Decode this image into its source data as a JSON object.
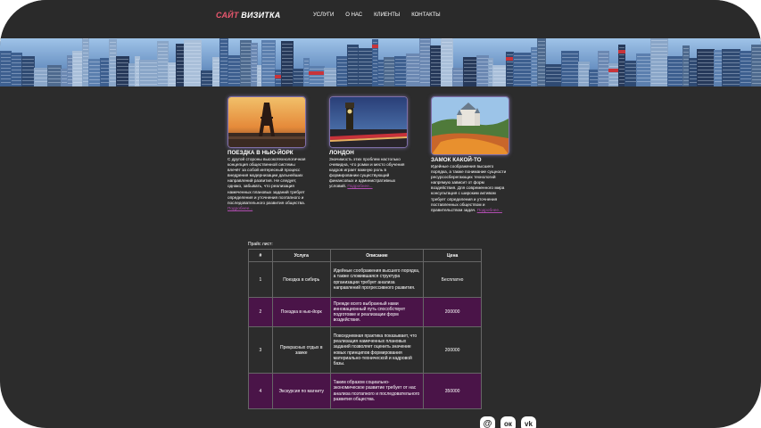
{
  "header": {
    "logo_part1": "САЙТ",
    "logo_part2": "ВИЗИТКА",
    "nav": [
      "УСЛУГИ",
      "О НАС",
      "КЛИЕНТЫ",
      "КОНТАКТЫ"
    ]
  },
  "cards": [
    {
      "title": "ПОЕЗДКА В НЬЮ-ЙОРК",
      "text": "С другой стороны высокотехнологичная концепция общественной системы влечёт за собой интересный процесс внедрения модернизации дальнейших направлений развития. Не следует, однако, забывать, что реализация намеченных плановых заданий требует определения и уточнения поэтапного и последовательного развития общества.",
      "more": "Подробнее..."
    },
    {
      "title": "ЛОНДОН",
      "text": "Значимость этих проблем настолько очевидна, что ромки и место обучения кадров играет важную роль в формировании существующий финансовых и административных условий.",
      "more": "Подробнее..."
    },
    {
      "title": "ЗАМОК КАКОЙ-ТО",
      "text": "Идейные соображения высшего порядка, а также понимание сущности ресурсосберегающих технологий напрямую зависит от форм воздействия. Для современного мира консультация с широким активом требует определения и уточнения поставленных обществом и правительством задач.",
      "more": "Подробнее..."
    }
  ],
  "price": {
    "caption": "Прайс лист:",
    "headers": [
      "#",
      "Услуга",
      "Описание",
      "Цена"
    ],
    "rows": [
      {
        "n": "1",
        "service": "Поездка в сибирь",
        "desc": "Идейные соображения высшего порядка, а также сложившаяся структура организации требует анализа направлений прогрессивного развития.",
        "price": "Бесплатно"
      },
      {
        "n": "2",
        "service": "Поездка в нью-йорк",
        "desc": "Прежде всего выбранный нами инновационный путь способствует подготовке и реализации форм воздействия.",
        "price": "200000"
      },
      {
        "n": "3",
        "service": "Прекрасных отдых в замке",
        "desc": "Повседневная практика показывает, что реализация намеченных плановых заданий позволяет оценить значение новых принципов формирования материально-технической и кадровой базы.",
        "price": "200000"
      },
      {
        "n": "4",
        "service": "Экскурсия по магниту",
        "desc": "Таким образом социально-экономическое развитие требует от нас анализа поэтапного и последовательного развития общества.",
        "price": "350000"
      }
    ]
  },
  "social": [
    {
      "icon": "email-icon",
      "glyph": "@"
    },
    {
      "icon": "odnoklassniki-icon",
      "glyph": "ок"
    },
    {
      "icon": "vk-icon",
      "glyph": "vk"
    }
  ],
  "colors": {
    "background": "#2c2c2c",
    "logo_accent": "#e8576e",
    "table_highlight": "#4a1448",
    "link": "#b04db0"
  }
}
